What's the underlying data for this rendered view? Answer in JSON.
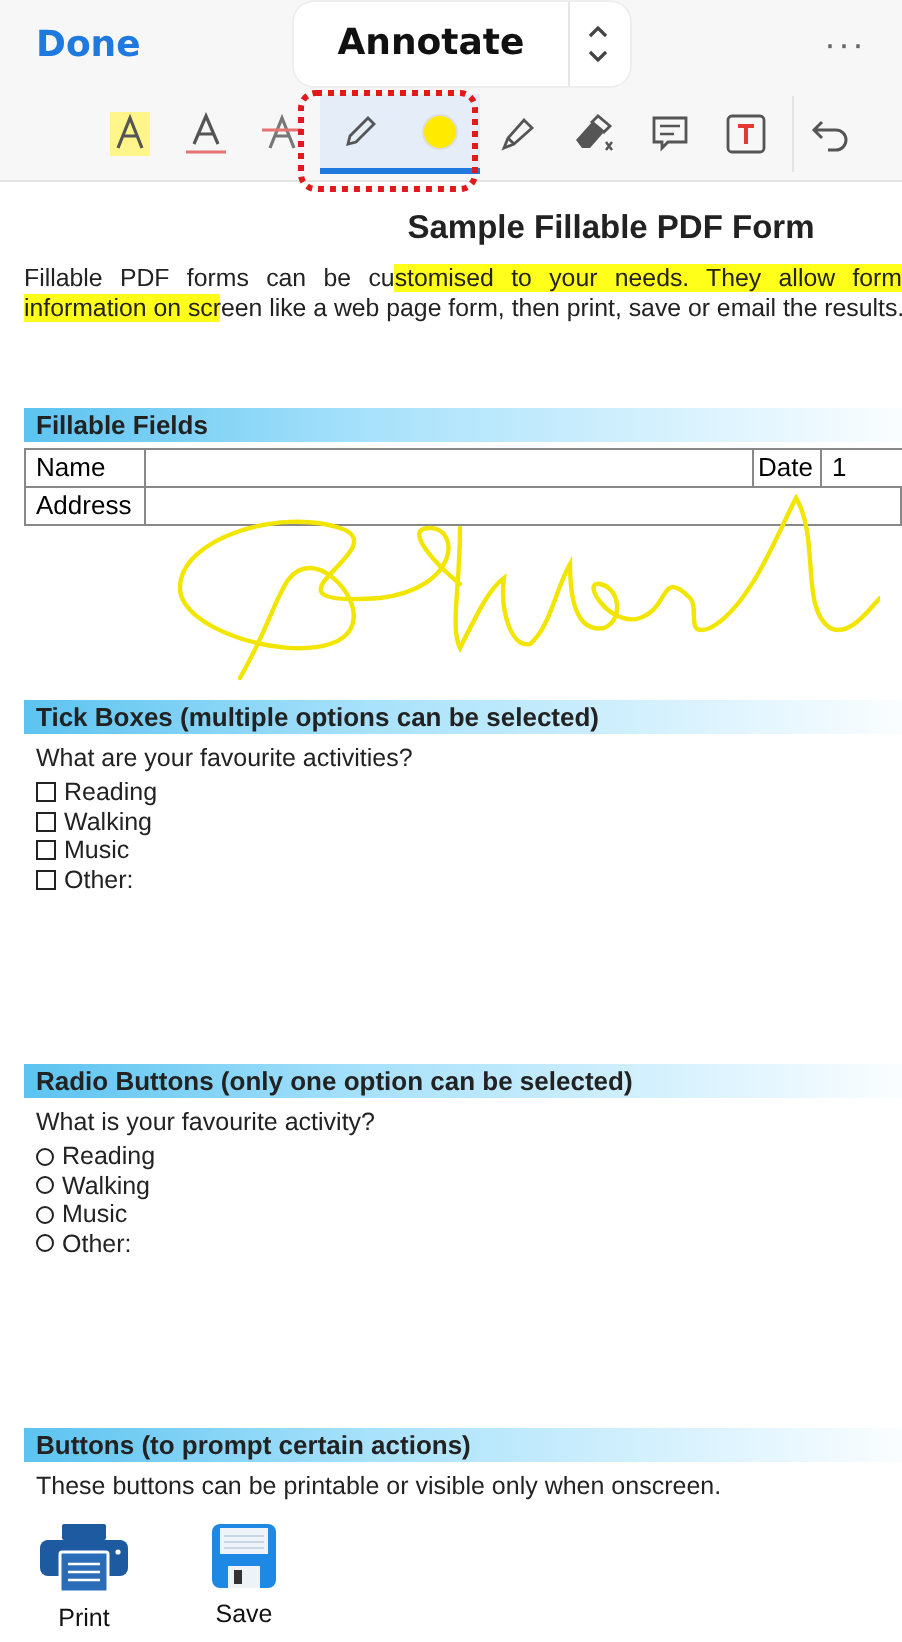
{
  "top_bar": {
    "done": "Done",
    "mode": "Annotate",
    "more": "···"
  },
  "tools": [
    {
      "kind": "highlight-text",
      "selected": false
    },
    {
      "kind": "underline-text",
      "selected": false
    },
    {
      "kind": "strike-text",
      "selected": false
    },
    {
      "kind": "pen",
      "selected": true
    },
    {
      "kind": "color",
      "selected": true,
      "color": "#ffea00"
    },
    {
      "kind": "marker",
      "selected": false
    },
    {
      "kind": "eraser",
      "selected": false
    },
    {
      "kind": "comment",
      "selected": false
    },
    {
      "kind": "textbox",
      "selected": false
    },
    {
      "kind": "undo",
      "selected": false
    }
  ],
  "document": {
    "title": "Sample Fillable PDF Form",
    "intro": [
      [
        {
          "text": "Fillable PDF forms can be cu",
          "highlighted": false
        },
        {
          "text": "stomised to your needs. They allow form",
          "highlighted": true
        }
      ],
      [
        {
          "text": "information on scr",
          "highlighted": true
        },
        {
          "text": "een like a web page form, then print, save or email the results.",
          "highlighted": false
        }
      ]
    ],
    "sections": [
      {
        "kind": "fields",
        "heading": "Fillable Fields",
        "rows": [
          {
            "label": "Name",
            "value": "",
            "extra_label": "Date",
            "extra_value": "1"
          },
          {
            "label": "Address",
            "value": ""
          }
        ]
      },
      {
        "kind": "checkboxes",
        "heading": "Tick Boxes (multiple options can be selected)",
        "question": "What are your favourite activities?",
        "options": [
          {
            "label": "Reading",
            "checked": false
          },
          {
            "label": "Walking",
            "checked": false
          },
          {
            "label": "Music",
            "checked": false
          },
          {
            "label": "Other:",
            "checked": false
          }
        ]
      },
      {
        "kind": "radios",
        "heading": "Radio Buttons (only one option can be selected)",
        "question": "What is your favourite activity?",
        "options": [
          {
            "label": "Reading",
            "selected": false
          },
          {
            "label": "Walking",
            "selected": false
          },
          {
            "label": "Music",
            "selected": false
          },
          {
            "label": "Other:",
            "selected": false
          }
        ]
      },
      {
        "kind": "buttons",
        "heading": "Buttons (to prompt certain actions)",
        "note": "These buttons can be printable or visible only when onscreen.",
        "buttons": [
          {
            "kind": "print",
            "label": "Print"
          },
          {
            "kind": "save",
            "label": "Save"
          }
        ]
      }
    ]
  }
}
